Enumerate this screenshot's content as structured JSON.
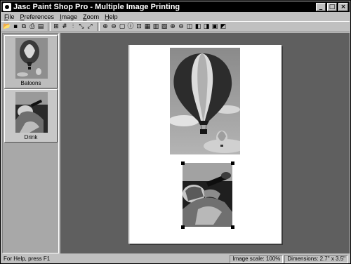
{
  "window": {
    "title": "Jasc Paint Shop Pro - Multiple Image Printing",
    "controls": [
      "minimize",
      "maximize",
      "close"
    ]
  },
  "menu": [
    {
      "label": "File",
      "underline_index": 0
    },
    {
      "label": "Preferences",
      "underline_index": 0
    },
    {
      "label": "Image",
      "underline_index": 0
    },
    {
      "label": "Zoom",
      "underline_index": 0
    },
    {
      "label": "Help",
      "underline_index": 0
    }
  ],
  "toolbar": {
    "buttons": [
      "open-icon",
      "save-icon",
      "copy-icon",
      "print-icon",
      "print-preview-icon",
      "grid-icon",
      "hash-grid-icon",
      "align-icon",
      "fit-icon",
      "stretch-icon",
      "zoom-in-icon",
      "zoom-out-icon",
      "page-icon",
      "info-icon",
      "place-icon",
      "layout-1-icon",
      "layout-2-icon",
      "layout-3-icon",
      "zoom-in-2-icon",
      "zoom-out-2-icon",
      "layout-4-icon",
      "layout-5-icon",
      "layout-6-icon",
      "layout-7-icon",
      "layout-8-icon"
    ]
  },
  "thumbnails": [
    {
      "label": "Baloons",
      "selected": true,
      "icon": "balloon-photo"
    },
    {
      "label": "Drink",
      "selected": false,
      "icon": "drink-photo"
    }
  ],
  "page": {
    "images": [
      {
        "name": "balloon-image",
        "icon": "balloon-photo",
        "selected": false
      },
      {
        "name": "drink-image",
        "icon": "drink-photo",
        "selected": true
      }
    ]
  },
  "status": {
    "help": "For Help, press F1",
    "scale": "Image scale: 100%",
    "dimensions": "Dimensions: 2.7\" x 3.5\""
  },
  "colors": {
    "titlebar": "#000000",
    "workspace": "#5f5f5f",
    "panel": "#a8a8a8",
    "page": "#ffffff"
  }
}
